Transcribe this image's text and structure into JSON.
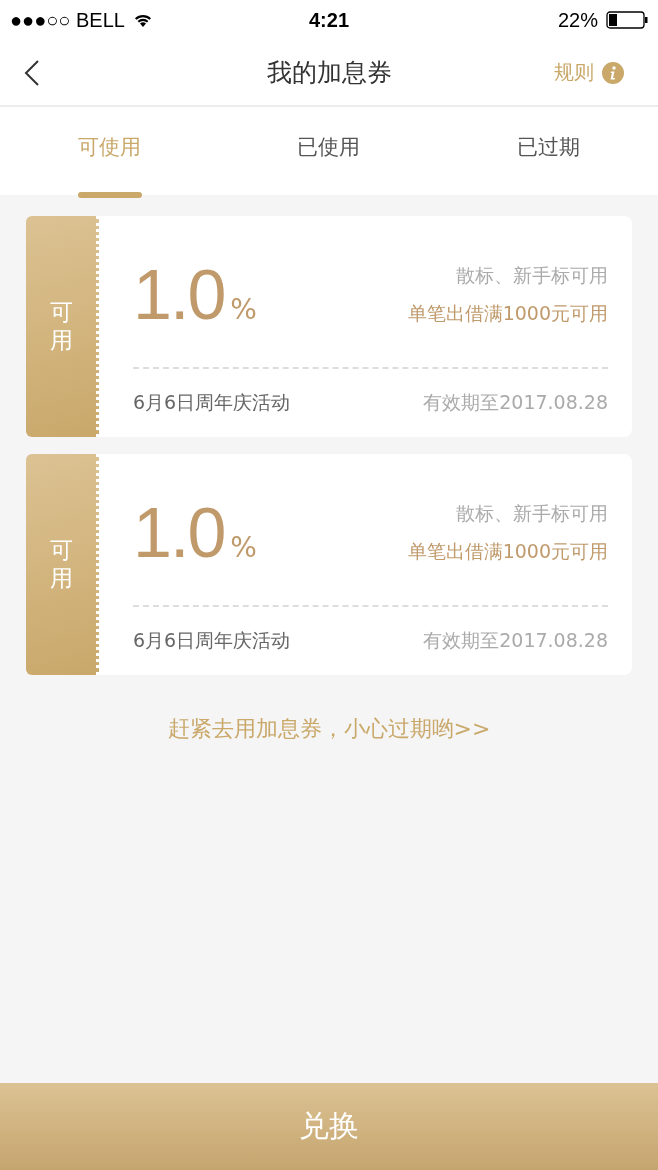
{
  "status_bar": {
    "carrier": "●●●○○ BELL",
    "time": "4:21",
    "battery": "22%"
  },
  "nav": {
    "title": "我的加息券",
    "rules": "规则"
  },
  "tabs": [
    {
      "label": "可使用",
      "selected": true
    },
    {
      "label": "已使用",
      "selected": false
    },
    {
      "label": "已过期",
      "selected": false
    }
  ],
  "coupons": [
    {
      "stub": "可用",
      "rate": "1.0",
      "unit": "%",
      "scope": "散标、新手标可用",
      "condition": "单笔出借满1000元可用",
      "source": "6月6日周年庆活动",
      "expiry": "有效期至2017.08.28"
    },
    {
      "stub": "可用",
      "rate": "1.0",
      "unit": "%",
      "scope": "散标、新手标可用",
      "condition": "单笔出借满1000元可用",
      "source": "6月6日周年庆活动",
      "expiry": "有效期至2017.08.28"
    }
  ],
  "hint_link": "赶紧去用加息券，小心过期哟>>",
  "bottom_button": "兑换"
}
